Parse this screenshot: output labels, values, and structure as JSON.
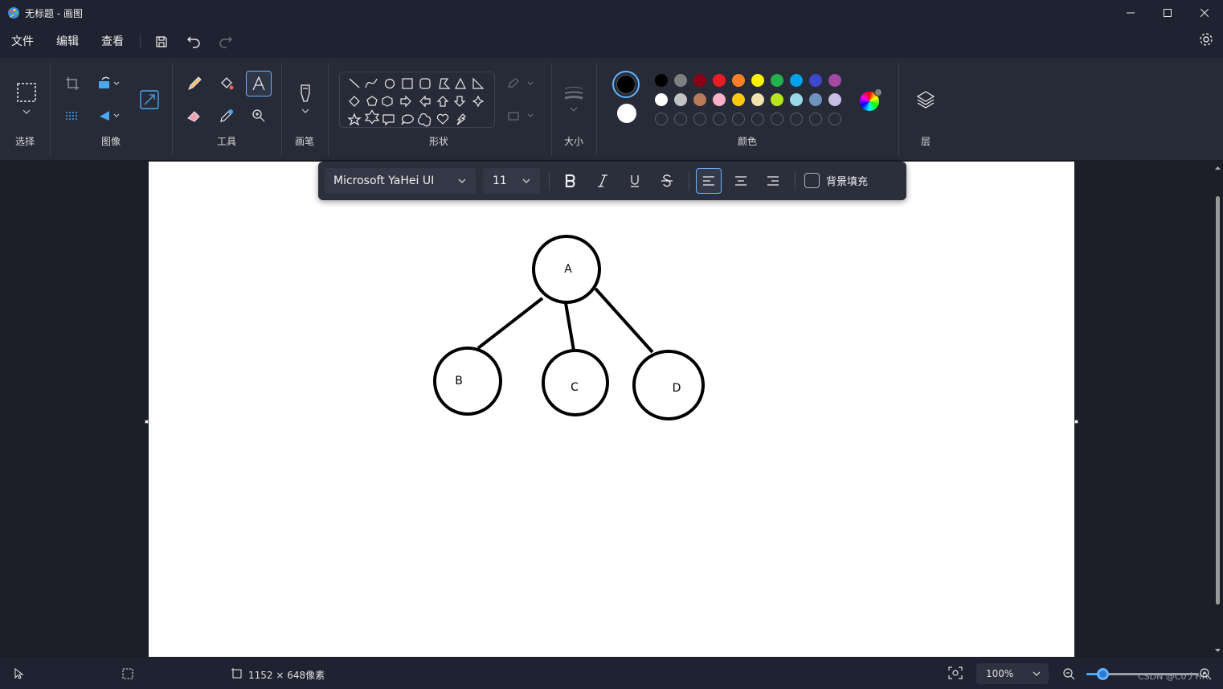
{
  "window": {
    "title": "无标题 - 画图"
  },
  "menu": {
    "file": "文件",
    "edit": "编辑",
    "view": "查看"
  },
  "ribbon": {
    "select_label": "选择",
    "image_label": "图像",
    "tools_label": "工具",
    "brush_label": "画笔",
    "shapes_label": "形状",
    "size_label": "大小",
    "colors_label": "颜色",
    "layers_label": "层"
  },
  "colors": {
    "primary": "#000000",
    "secondary": "#ffffff",
    "row1": [
      "#000000",
      "#7f7f7f",
      "#880015",
      "#ed1c24",
      "#ff7f27",
      "#fff200",
      "#22b14c",
      "#00a2e8",
      "#3f48cc",
      "#a349a4"
    ],
    "row2": [
      "#ffffff",
      "#c3c3c3",
      "#b97a57",
      "#ffaec9",
      "#ffc90e",
      "#efe4b0",
      "#b5e61d",
      "#99d9ea",
      "#7092be",
      "#c8bfe7"
    ]
  },
  "text_toolbar": {
    "font": "Microsoft YaHei UI",
    "size": "11",
    "bg_fill_label": "背景填充"
  },
  "drawing": {
    "nodes": [
      "A",
      "B",
      "C",
      "D"
    ]
  },
  "status": {
    "canvas_size": "1152 × 648像素",
    "zoom": "100%",
    "watermark": "CSDN @C0丿HR"
  }
}
